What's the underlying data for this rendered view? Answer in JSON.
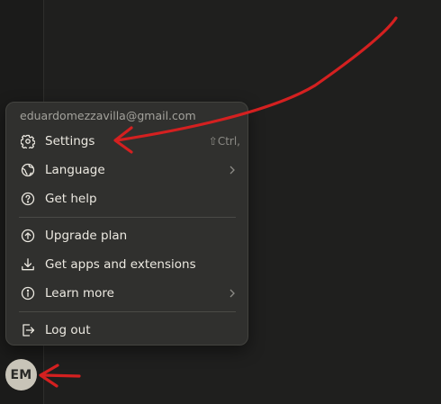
{
  "account": {
    "email": "eduardomezzavilla@gmail.com",
    "avatar_initials": "EM"
  },
  "menu": {
    "settings": {
      "label": "Settings",
      "shortcut": "⇧Ctrl,",
      "icon": "gear-icon"
    },
    "language": {
      "label": "Language",
      "icon": "globe-icon",
      "has_submenu": true
    },
    "help": {
      "label": "Get help",
      "icon": "question-circle-icon"
    },
    "upgrade": {
      "label": "Upgrade plan",
      "icon": "arrow-up-circle-icon"
    },
    "apps": {
      "label": "Get apps and extensions",
      "icon": "download-icon"
    },
    "learn": {
      "label": "Learn more",
      "icon": "info-circle-icon",
      "has_submenu": true
    },
    "logout": {
      "label": "Log out",
      "icon": "log-out-icon"
    }
  },
  "colors": {
    "background": "#1f1f1e",
    "menu_background": "#30302e",
    "text": "#ece9e1",
    "muted_text": "#a3a29c",
    "annotation_red": "#d42020",
    "avatar_background": "#c8c4b8"
  }
}
